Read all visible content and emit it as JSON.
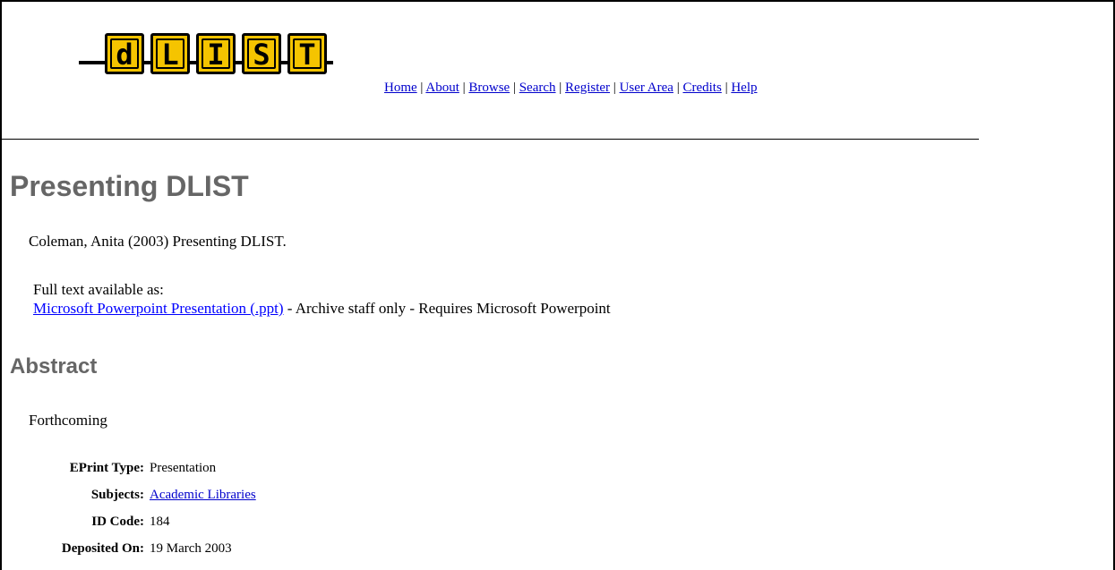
{
  "logo": {
    "letters": [
      "d",
      "L",
      "I",
      "S",
      "T"
    ]
  },
  "nav": {
    "items": [
      "Home",
      "About",
      "Browse",
      "Search",
      "Register",
      "User Area",
      "Credits",
      "Help"
    ],
    "separator": " | "
  },
  "page": {
    "title": "Presenting DLIST",
    "citation": "Coleman, Anita (2003) Presenting DLIST.",
    "full_text_label": "Full text available as:",
    "file_link": "Microsoft Powerpoint Presentation (.ppt)",
    "file_note": " - Archive staff only - Requires Microsoft Powerpoint",
    "abstract_heading": "Abstract",
    "abstract_text": "Forthcoming"
  },
  "metadata": [
    {
      "label": "EPrint Type:",
      "value": "Presentation"
    },
    {
      "label": "Subjects:",
      "value": "Academic Libraries"
    },
    {
      "label": "ID Code:",
      "value": "184"
    },
    {
      "label": "Deposited On:",
      "value": "19 March 2003"
    }
  ],
  "colors": {
    "link": "#0000cc",
    "heading": "#666666",
    "logo_yellow": "#f5c400"
  }
}
